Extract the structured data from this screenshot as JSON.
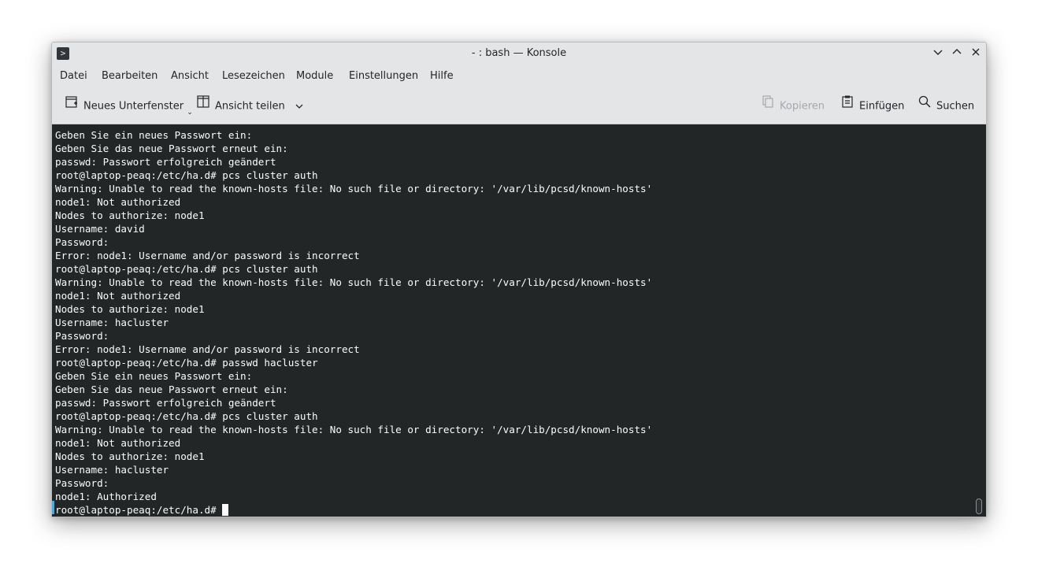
{
  "window": {
    "title": "- : bash — Konsole",
    "controls": [
      "minimize",
      "maximize",
      "close"
    ]
  },
  "menu": [
    "Datei",
    "Bearbeiten",
    "Ansicht",
    "Lesezeichen",
    "Module",
    "Einstellungen",
    "Hilfe"
  ],
  "toolbar": {
    "new_tab": "Neues Unterfenster",
    "split_view": "Ansicht teilen",
    "copy": "Kopieren",
    "paste": "Einfügen",
    "search": "Suchen"
  },
  "terminal": {
    "lines": [
      "Geben Sie ein neues Passwort ein:",
      "Geben Sie das neue Passwort erneut ein:",
      "passwd: Passwort erfolgreich geändert",
      "root@laptop-peaq:/etc/ha.d# pcs cluster auth",
      "Warning: Unable to read the known-hosts file: No such file or directory: '/var/lib/pcsd/known-hosts'",
      "node1: Not authorized",
      "Nodes to authorize: node1",
      "Username: david",
      "Password:",
      "Error: node1: Username and/or password is incorrect",
      "root@laptop-peaq:/etc/ha.d# pcs cluster auth",
      "Warning: Unable to read the known-hosts file: No such file or directory: '/var/lib/pcsd/known-hosts'",
      "node1: Not authorized",
      "Nodes to authorize: node1",
      "Username: hacluster",
      "Password:",
      "Error: node1: Username and/or password is incorrect",
      "root@laptop-peaq:/etc/ha.d# passwd hacluster",
      "Geben Sie ein neues Passwort ein:",
      "Geben Sie das neue Passwort erneut ein:",
      "passwd: Passwort erfolgreich geändert",
      "root@laptop-peaq:/etc/ha.d# pcs cluster auth",
      "Warning: Unable to read the known-hosts file: No such file or directory: '/var/lib/pcsd/known-hosts'",
      "node1: Not authorized",
      "Nodes to authorize: node1",
      "Username: hacluster",
      "Password:",
      "node1: Authorized"
    ],
    "prompt": "root@laptop-peaq:/etc/ha.d# "
  },
  "colors": {
    "terminal_bg": "#232627",
    "terminal_fg": "#fcfcfc",
    "chrome_bg": "#e3e5e7",
    "accent": "#3daee9"
  }
}
